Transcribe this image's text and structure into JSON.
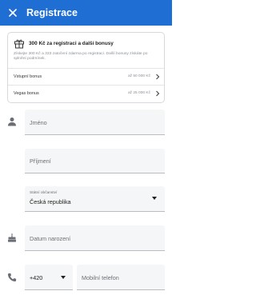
{
  "colors": {
    "accent": "#1f6ed4",
    "field_bg": "#f5f6f7"
  },
  "header": {
    "title": "Registrace",
    "close_icon": "close-icon"
  },
  "bonus": {
    "title": "300 Kč za registraci a další bonusy",
    "description": "Získejte 300 Kč a 333 zatočení zdarma po registraci. Další bonusy získáte po splnění podmínek.",
    "rows": [
      {
        "label": "Vstupní bonus",
        "value": "až 50 000 Kč"
      },
      {
        "label": "Vegas bonus",
        "value": "až 25 000 Kč"
      }
    ]
  },
  "form": {
    "first_name_placeholder": "Jméno",
    "last_name_placeholder": "Příjmení",
    "citizenship": {
      "label": "Státní občanství",
      "value": "Česká republika"
    },
    "birth_date_placeholder": "Datum narození",
    "phone_prefix": "+420",
    "phone_placeholder": "Mobilní telefon"
  }
}
